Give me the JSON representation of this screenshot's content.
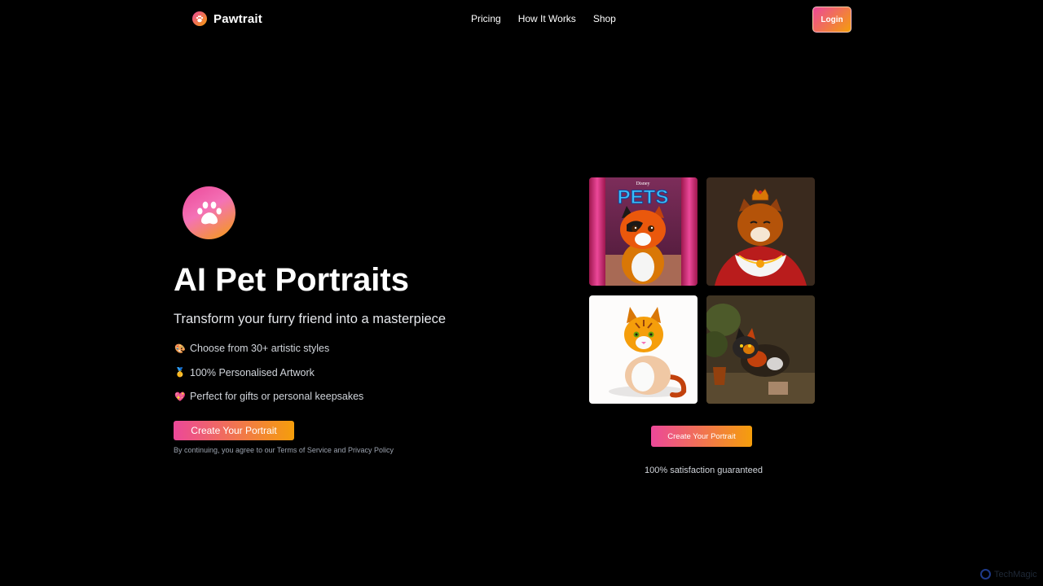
{
  "nav": {
    "brand": "Pawtrait",
    "links": [
      "Pricing",
      "How It Works",
      "Shop"
    ],
    "login": "Login"
  },
  "hero": {
    "title": "AI Pet Portraits",
    "subtitle": "Transform your furry friend into a masterpiece",
    "features": [
      {
        "icon": "palette-icon",
        "text": "Choose from 30+ artistic styles"
      },
      {
        "icon": "medal-icon",
        "text": "100% Personalised Artwork"
      },
      {
        "icon": "heart-icon",
        "text": "Perfect for gifts or personal keepsakes"
      }
    ],
    "cta": "Create Your Portrait",
    "legal_prefix": "By continuing, you agree to our ",
    "terms": "Terms of Service",
    "legal_and": " and ",
    "privacy": "Privacy Policy"
  },
  "gallery": {
    "tiles": [
      {
        "style": "movie-poster",
        "poster_brand": "Disney",
        "poster_title": "PETS"
      },
      {
        "style": "royal-painting"
      },
      {
        "style": "watercolor"
      },
      {
        "style": "oil-painting"
      }
    ],
    "cta": "Create Your Portrait",
    "guarantee": "100% satisfaction guaranteed"
  },
  "watermark": "TechMagic",
  "colors": {
    "background": "#000000",
    "accent_pink": "#ec4899",
    "accent_orange": "#f59e0b"
  }
}
